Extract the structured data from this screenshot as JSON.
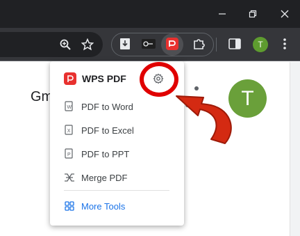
{
  "window": {
    "title_bar_color": "#202124",
    "controls": [
      "minimize-icon",
      "restore-icon",
      "close-icon"
    ]
  },
  "toolbar": {
    "icons": [
      "zoom-icon",
      "bookmark-star-icon"
    ],
    "extensions": [
      "extension-download-icon",
      "extension-link-icon",
      "wps-pdf-extension-icon",
      "puzzle-icon"
    ],
    "side_panel_icon": "side-panel-icon",
    "profile_initial": "T",
    "menu_icon": "kebab-menu-icon"
  },
  "page": {
    "partial_text": "Gm",
    "avatar_initial": "T",
    "avatar_color": "#6aa03a"
  },
  "popup": {
    "brand_name": "WPS PDF",
    "brand_color": "#e8312f",
    "settings_icon": "gear-icon",
    "items": [
      {
        "label": "PDF to Word",
        "icon": "pdf-to-word-icon"
      },
      {
        "label": "PDF to Excel",
        "icon": "pdf-to-excel-icon"
      },
      {
        "label": "PDF to PPT",
        "icon": "pdf-to-ppt-icon"
      },
      {
        "label": "Merge PDF",
        "icon": "merge-pdf-icon"
      }
    ],
    "more_tools": {
      "label": "More Tools",
      "icon": "grid-icon",
      "color": "#1a73e8"
    }
  },
  "annotation": {
    "highlight_color": "#e00000",
    "arrow_color": "#d42a12"
  }
}
